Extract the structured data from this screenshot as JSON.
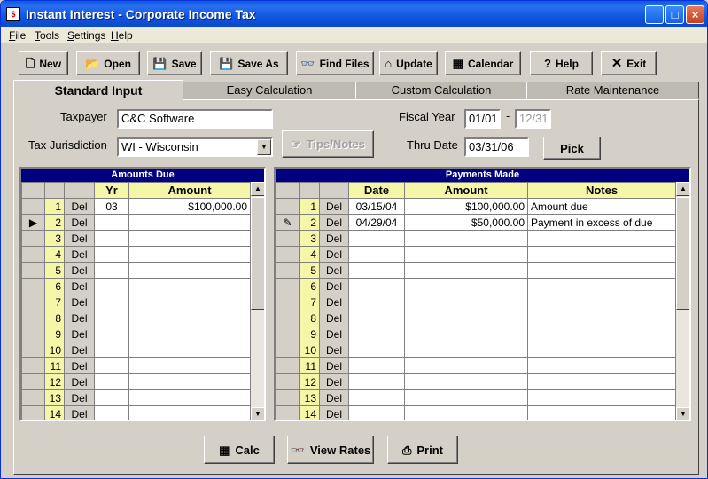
{
  "window": {
    "title": "Instant Interest - Corporate Income Tax",
    "minimize": "_",
    "maximize": "□",
    "close": "×"
  },
  "menu": [
    {
      "ul": "F",
      "rest": "ile"
    },
    {
      "ul": "T",
      "rest": "ools"
    },
    {
      "ul": "S",
      "rest": "ettings"
    },
    {
      "ul": "H",
      "rest": "elp"
    }
  ],
  "toolbar": {
    "new": "New",
    "open": "Open",
    "save": "Save",
    "save_as": "Save As",
    "find_files": "Find Files",
    "update": "Update",
    "calendar": "Calendar",
    "help": "Help",
    "exit": "Exit"
  },
  "tabs": [
    "Standard Input",
    "Easy Calculation",
    "Custom Calculation",
    "Rate Maintenance"
  ],
  "form": {
    "taxpayer_label": "Taxpayer",
    "taxpayer_value": "C&C Software",
    "jurisdiction_label": "Tax Jurisdiction",
    "jurisdiction_value": "WI  - Wisconsin",
    "tips_label": "Tips/Notes",
    "fiscal_year_label": "Fiscal Year",
    "fiscal_start": "01/01",
    "fiscal_sep": "-",
    "fiscal_end": "12/31",
    "thru_date_label": "Thru Date",
    "thru_date_value": "03/31/06",
    "pick_label": "Pick"
  },
  "amounts_due": {
    "title": "Amounts Due",
    "headers": {
      "yr": "Yr",
      "amount": "Amount"
    },
    "del_label": "Del",
    "current_row_marker": "▶",
    "rows": [
      {
        "n": "1",
        "yr": "03",
        "amount": "$100,000.00"
      },
      {
        "n": "2",
        "yr": "",
        "amount": ""
      },
      {
        "n": "3",
        "yr": "",
        "amount": ""
      },
      {
        "n": "4",
        "yr": "",
        "amount": ""
      },
      {
        "n": "5",
        "yr": "",
        "amount": ""
      },
      {
        "n": "6",
        "yr": "",
        "amount": ""
      },
      {
        "n": "7",
        "yr": "",
        "amount": ""
      },
      {
        "n": "8",
        "yr": "",
        "amount": ""
      },
      {
        "n": "9",
        "yr": "",
        "amount": ""
      },
      {
        "n": "10",
        "yr": "",
        "amount": ""
      },
      {
        "n": "11",
        "yr": "",
        "amount": ""
      },
      {
        "n": "12",
        "yr": "",
        "amount": ""
      },
      {
        "n": "13",
        "yr": "",
        "amount": ""
      },
      {
        "n": "14",
        "yr": "",
        "amount": ""
      }
    ]
  },
  "payments_made": {
    "title": "Payments Made",
    "headers": {
      "date": "Date",
      "amount": "Amount",
      "notes": "Notes"
    },
    "del_label": "Del",
    "edit_row_marker": "✎",
    "rows": [
      {
        "n": "1",
        "date": "03/15/04",
        "amount": "$100,000.00",
        "notes": "Amount due"
      },
      {
        "n": "2",
        "date": "04/29/04",
        "amount": "$50,000.00",
        "notes": "Payment in excess of due"
      },
      {
        "n": "3",
        "date": "",
        "amount": "",
        "notes": ""
      },
      {
        "n": "4",
        "date": "",
        "amount": "",
        "notes": ""
      },
      {
        "n": "5",
        "date": "",
        "amount": "",
        "notes": ""
      },
      {
        "n": "6",
        "date": "",
        "amount": "",
        "notes": ""
      },
      {
        "n": "7",
        "date": "",
        "amount": "",
        "notes": ""
      },
      {
        "n": "8",
        "date": "",
        "amount": "",
        "notes": ""
      },
      {
        "n": "9",
        "date": "",
        "amount": "",
        "notes": ""
      },
      {
        "n": "10",
        "date": "",
        "amount": "",
        "notes": ""
      },
      {
        "n": "11",
        "date": "",
        "amount": "",
        "notes": ""
      },
      {
        "n": "12",
        "date": "",
        "amount": "",
        "notes": ""
      },
      {
        "n": "13",
        "date": "",
        "amount": "",
        "notes": ""
      },
      {
        "n": "14",
        "date": "",
        "amount": "",
        "notes": ""
      }
    ]
  },
  "bottom": {
    "calc": "Calc",
    "view_rates": "View Rates",
    "print": "Print"
  },
  "colors": {
    "title_bar": "#0a5de0",
    "grid_header": "#f6f6a8",
    "grid_title": "#000080",
    "face": "#d4d0c8"
  }
}
